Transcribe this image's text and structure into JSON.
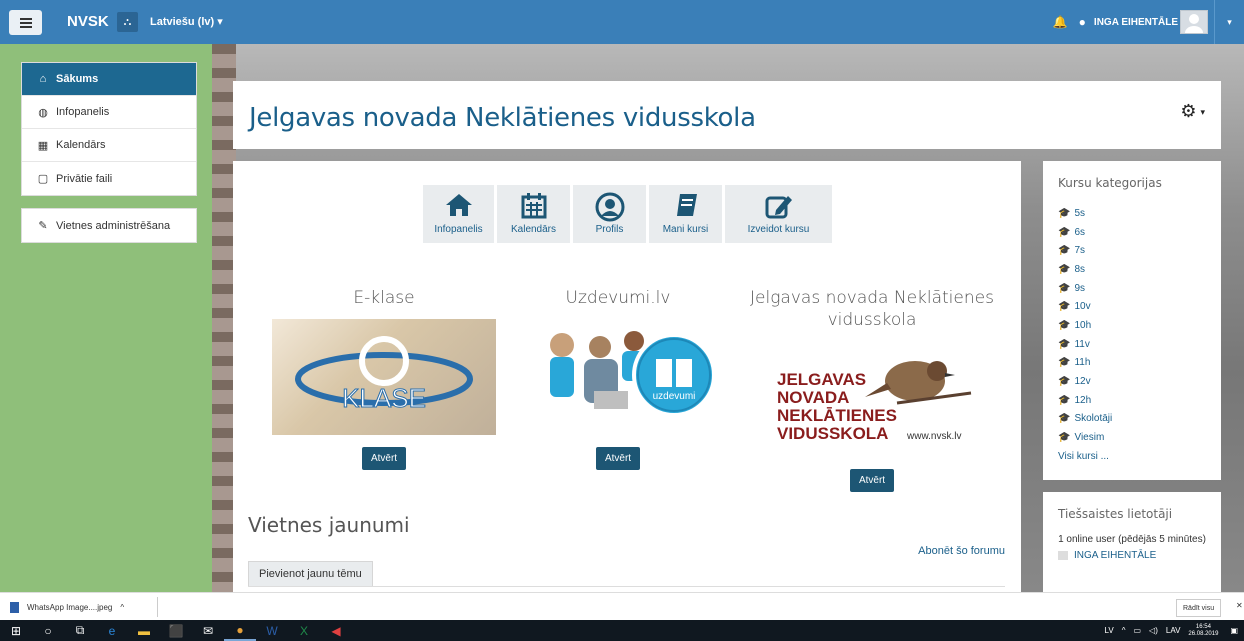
{
  "navbar": {
    "brand": "NVSK",
    "language": "Latviešu (lv)",
    "user_name": "INGA EIHENTĀLE"
  },
  "drawer": {
    "items": [
      {
        "label": "Sākums",
        "icon": "home-icon"
      },
      {
        "label": "Infopanelis",
        "icon": "dashboard-icon"
      },
      {
        "label": "Kalendārs",
        "icon": "calendar-icon"
      },
      {
        "label": "Privātie faili",
        "icon": "file-icon"
      }
    ],
    "admin": {
      "label": "Vietnes administrēšana",
      "icon": "wrench-icon"
    }
  },
  "header": {
    "title": "Jelgavas novada Neklātienes vidusskola"
  },
  "quick_links": [
    {
      "label": "Infopanelis",
      "icon": "home-icon"
    },
    {
      "label": "Kalendārs",
      "icon": "calendar-icon"
    },
    {
      "label": "Profils",
      "icon": "user-icon"
    },
    {
      "label": "Mani kursi",
      "icon": "book-icon"
    },
    {
      "label": "Izveidot kursu",
      "icon": "edit-icon"
    }
  ],
  "sites": [
    {
      "title": "E-klase",
      "button": "Atvērt",
      "logo_text": "KLASE"
    },
    {
      "title": "Uzdevumi.lv",
      "button": "Atvērt",
      "logo_text": "uzdevumi"
    },
    {
      "title": "Jelgavas novada Neklātienes vidusskola",
      "button": "Atvērt",
      "logo_lines": [
        "JELGAVAS",
        "NOVADA",
        "NEKLĀTIENES",
        "VIDUSSKOLA"
      ],
      "logo_url": "www.nvsk.lv"
    }
  ],
  "news": {
    "title": "Vietnes jaunumi",
    "subscribe": "Abonēt šo forumu",
    "new_topic": "Pievienot jaunu tēmu"
  },
  "categories": {
    "title": "Kursu kategorijas",
    "items": [
      "5s",
      "6s",
      "7s",
      "8s",
      "9s",
      "10v",
      "10h",
      "11v",
      "11h",
      "12v",
      "12h",
      "Skolotāji",
      "Viesim"
    ],
    "all_courses": "Visi kursi ..."
  },
  "online": {
    "title": "Tiešsaistes lietotāji",
    "summary": "1 online user (pēdējās 5 minūtes)",
    "user": "INGA EIHENTĀLE"
  },
  "downloads": {
    "file": "WhatsApp Image....jpeg",
    "show_all": "Rādīt visu"
  },
  "taskbar": {
    "lang1": "LV",
    "lang2": "LAV",
    "time": "16:54",
    "date": "26.08.2019"
  },
  "colors": {
    "navbar": "#3a7fb8",
    "primary_button": "#1d5674",
    "link": "#1a5f8a"
  }
}
